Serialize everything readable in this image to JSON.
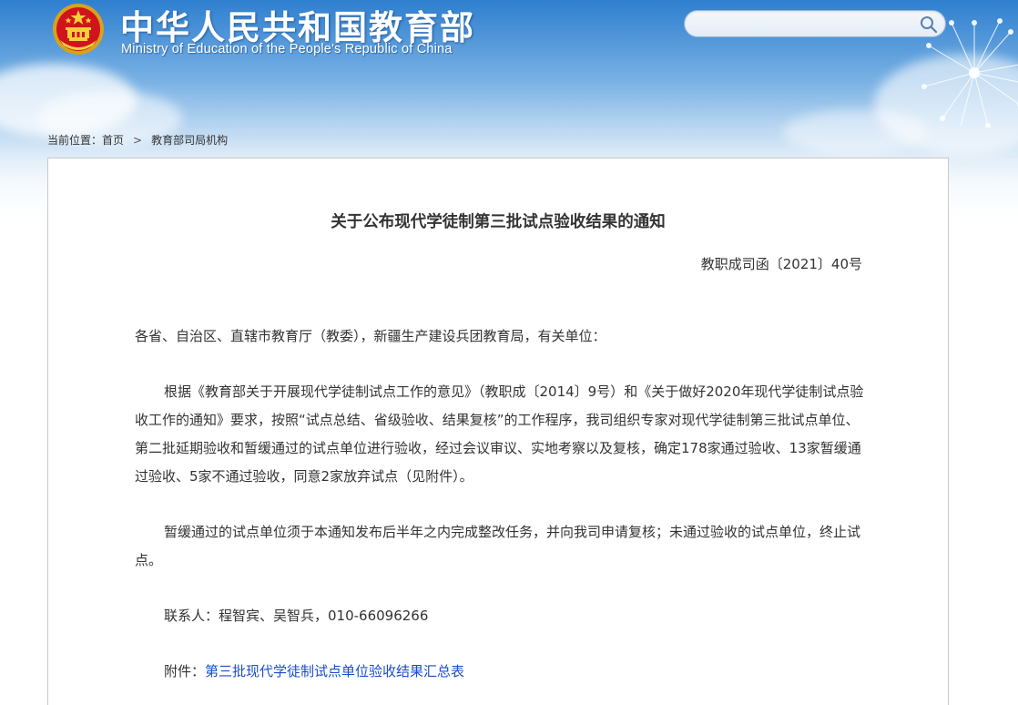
{
  "header": {
    "title": "中华人民共和国教育部",
    "subtitle": "Ministry of Education of the People's Republic of China",
    "search": {
      "value": "",
      "placeholder": ""
    }
  },
  "breadcrumb": {
    "prefix": "当前位置：",
    "items": [
      "首页",
      "教育部司局机构"
    ],
    "separator": ">"
  },
  "document": {
    "title": "关于公布现代学徒制第三批试点验收结果的通知",
    "number": "教职成司函〔2021〕40号",
    "greeting": "各省、自治区、直辖市教育厅（教委），新疆生产建设兵团教育局，有关单位：",
    "paragraph1": "根据《教育部关于开展现代学徒制试点工作的意见》（教职成〔2014〕9号）和《关于做好2020年现代学徒制试点验收工作的通知》要求，按照“试点总结、省级验收、结果复核”的工作程序，我司组织专家对现代学徒制第三批试点单位、第二批延期验收和暂缓通过的试点单位进行验收，经过会议审议、实地考察以及复核，确定178家通过验收、13家暂缓通过验收、5家不通过验收，同意2家放弃试点（见附件）。",
    "paragraph2": "暂缓通过的试点单位须于本通知发布后半年之内完成整改任务，并向我司申请复核；未通过验收的试点单位，终止试点。",
    "contact": "联系人：程智宾、吴智兵，010-66096266",
    "attachment_label": "附件：",
    "attachment_link": "第三批现代学徒制试点单位验收结果汇总表"
  },
  "colors": {
    "header_blue": "#2f7fcf",
    "text": "#333333",
    "link": "#1a4dcc",
    "border": "#c9c9c9"
  }
}
